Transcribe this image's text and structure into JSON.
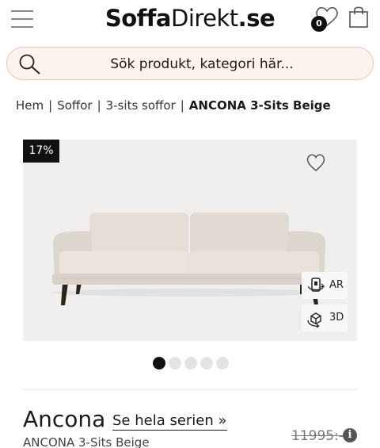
{
  "header": {
    "logo_part1": "Soffa",
    "logo_part2": "Direkt",
    "logo_part3": ".se",
    "wishlist_count": "0",
    "icons": [
      "menu-icon",
      "heart-icon",
      "shopping-bag-icon"
    ]
  },
  "search": {
    "placeholder": "Sök produkt, kategori här...",
    "icon": "search-icon"
  },
  "breadcrumb": {
    "items": [
      "Hem",
      "Soffor",
      "3-sits soffor"
    ],
    "current": "ANCONA 3-Sits Beige",
    "separator": "|"
  },
  "gallery": {
    "discount_badge": "17%",
    "ar_label": "AR",
    "threed_label": "3D",
    "slide_count": 5,
    "active_slide": 1
  },
  "product": {
    "name": "Ancona",
    "series_link": "Se hela serien »",
    "subtitle": "ANCONA 3-Sits Beige",
    "old_price": "11995:-",
    "info_icon": "i"
  },
  "colors": {
    "accent": "#111111",
    "search_bg": "#fdf3ee",
    "sofa_fabric": "#e2dbd3"
  }
}
